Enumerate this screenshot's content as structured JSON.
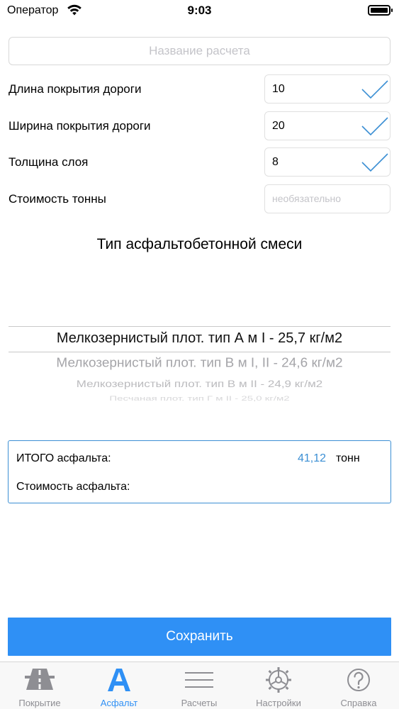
{
  "status_bar": {
    "carrier": "Оператор",
    "time": "9:03"
  },
  "calculation_name": {
    "placeholder": "Название расчета",
    "value": ""
  },
  "params": [
    {
      "label": "Длина покрытия дороги",
      "value": "10",
      "placeholder": "",
      "confirmed": true
    },
    {
      "label": "Ширина покрытия дороги",
      "value": "20",
      "placeholder": "",
      "confirmed": true
    },
    {
      "label": "Толщина слоя",
      "value": "8",
      "placeholder": "",
      "confirmed": true
    },
    {
      "label": "Стоимость тонны",
      "value": "",
      "placeholder": "необязательно",
      "confirmed": false
    }
  ],
  "mix_section_title": "Тип асфальтобетонной смеси",
  "mix_picker": {
    "selected_index": 0,
    "options": [
      "Мелкозернистый плот. тип А м I  - 25,7 кг/м2",
      "Мелкозернистый плот. тип В м I, II - 24,6 кг/м2",
      "Мелкозернистый плот. тип В м II - 24,9 кг/м2",
      "Песчаная плот. тип Г м II - 25,0 кг/м2"
    ]
  },
  "result": {
    "total_label": "ИТОГО асфальта:",
    "total_value": "41,12",
    "total_unit": "тонн",
    "cost_label": "Стоимость асфальта:"
  },
  "save_label": "Сохранить",
  "tabs": [
    {
      "label": "Покрытие",
      "icon": "road-icon",
      "active": false
    },
    {
      "label": "Асфальт",
      "icon": "letter-a-icon",
      "active": true
    },
    {
      "label": "Расчеты",
      "icon": "list-lines-icon",
      "active": false
    },
    {
      "label": "Настройки",
      "icon": "gear-icon",
      "active": false
    },
    {
      "label": "Справка",
      "icon": "help-icon",
      "active": false
    }
  ],
  "colors": {
    "accent": "#2f90f5",
    "result_border": "#3b8fd4",
    "check": "#3b8fd4",
    "inactive_tab": "#8e8e93"
  }
}
